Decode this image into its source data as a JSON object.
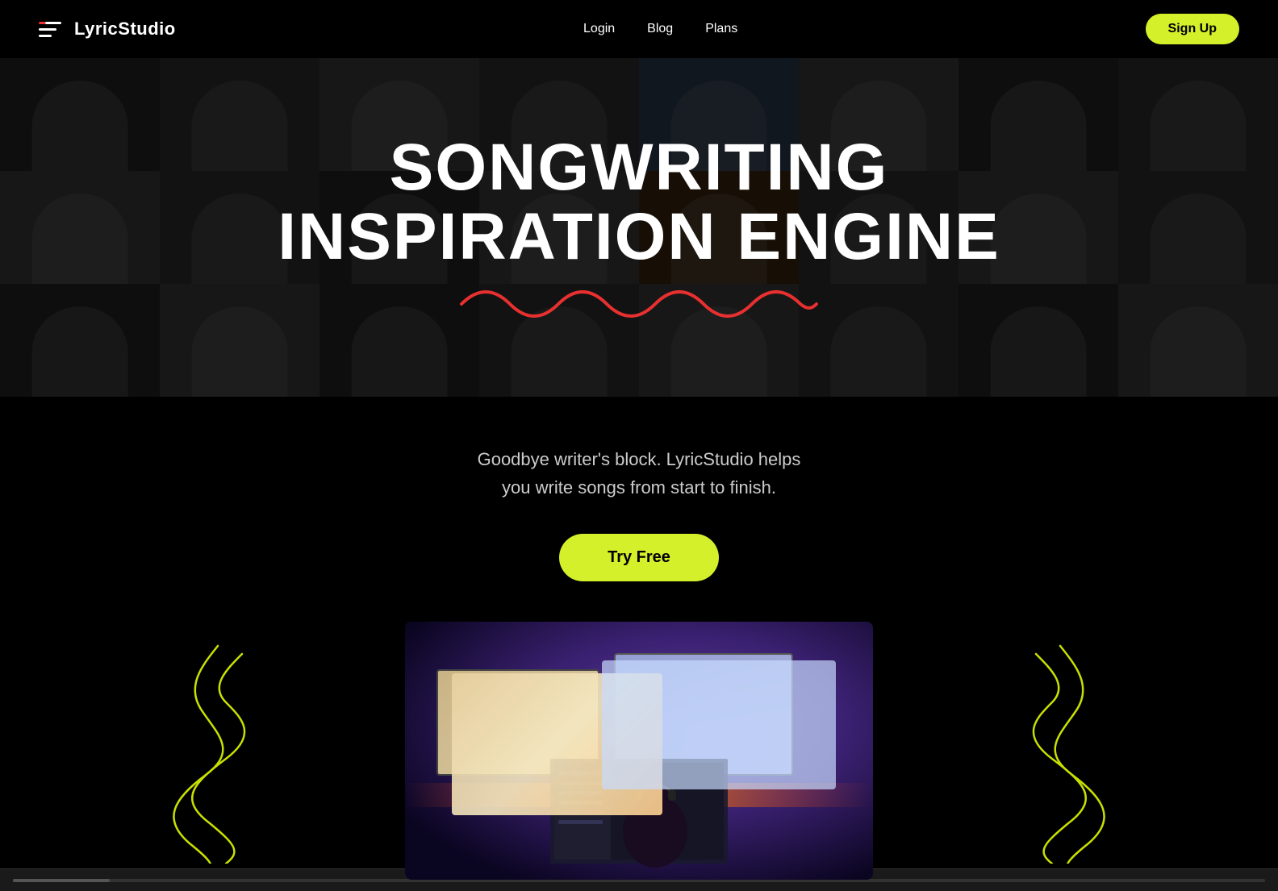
{
  "brand": {
    "name": "LyricStudio",
    "logo_alt": "LyricStudio logo"
  },
  "navbar": {
    "login_label": "Login",
    "blog_label": "Blog",
    "plans_label": "Plans",
    "signup_label": "Sign Up"
  },
  "hero": {
    "title_line1": "SONGWRITING",
    "title_line2": "INSPIRATION ENGINE"
  },
  "subtitle": {
    "text": "Goodbye writer's block. LyricStudio helps\nyou write songs from start to finish.",
    "cta_label": "Try Free"
  },
  "colors": {
    "accent_yellow": "#d4f02a",
    "accent_red": "#e83030",
    "background": "#000000",
    "text_primary": "#ffffff",
    "text_secondary": "#cccccc"
  }
}
